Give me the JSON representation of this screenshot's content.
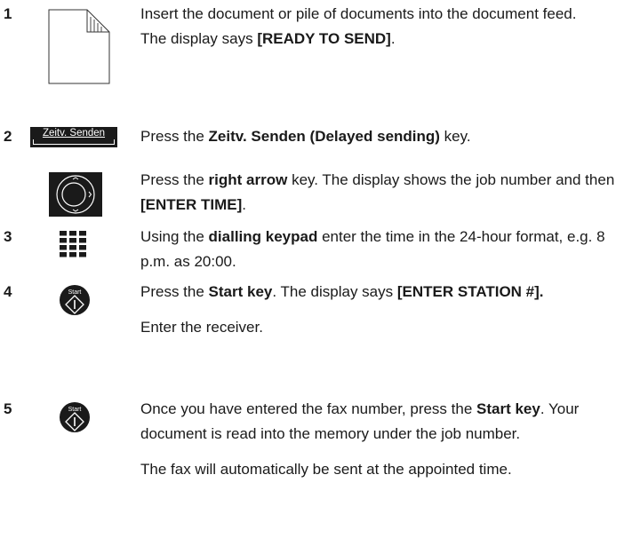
{
  "steps": [
    {
      "number": "1",
      "icon": "document-icon",
      "paragraphs": [
        [
          {
            "t": "Insert the document or pile of documents into the document feed."
          }
        ],
        [
          {
            "t": "The display says "
          },
          {
            "t": "[READY TO SEND]",
            "b": true
          },
          {
            "t": "."
          }
        ]
      ]
    },
    {
      "number": "2",
      "icon": "delayed-sending-key-icon",
      "key_label": "Zeitv. Senden",
      "paragraphs": [
        [
          {
            "t": "Press the "
          },
          {
            "t": "Zeitv. Senden (Delayed sending)",
            "b": true
          },
          {
            "t": " key."
          }
        ]
      ]
    },
    {
      "number": "",
      "icon": "navigation-key-icon",
      "paragraphs": [
        [
          {
            "t": "Press the "
          },
          {
            "t": "right arrow",
            "b": true
          },
          {
            "t": " key. The display shows the job number and then "
          },
          {
            "t": "[ENTER TIME]",
            "b": true
          },
          {
            "t": "."
          }
        ]
      ]
    },
    {
      "number": "3",
      "icon": "keypad-icon",
      "paragraphs": [
        [
          {
            "t": "Using the "
          },
          {
            "t": "dialling keypad",
            "b": true
          },
          {
            "t": " enter the time in the 24-hour format, e.g. 8 p.m. as 20:00."
          }
        ]
      ]
    },
    {
      "number": "4",
      "icon": "start-key-icon",
      "start_label": "Start",
      "paragraphs": [
        [
          {
            "t": "Press the "
          },
          {
            "t": "Start key",
            "b": true
          },
          {
            "t": ". The display says "
          },
          {
            "t": "[ENTER STATION #].",
            "b": true
          }
        ],
        [
          {
            "t": "Enter the receiver."
          }
        ]
      ]
    },
    {
      "number": "5",
      "icon": "start-key-icon",
      "start_label": "Start",
      "paragraphs": [
        [
          {
            "t": "Once you have entered the fax number, press the "
          },
          {
            "t": "Start key",
            "b": true
          },
          {
            "t": ". Your document is read into the memory under the job number."
          }
        ],
        [
          {
            "t": "The fax will automatically be sent at the appointed time."
          }
        ]
      ]
    }
  ]
}
